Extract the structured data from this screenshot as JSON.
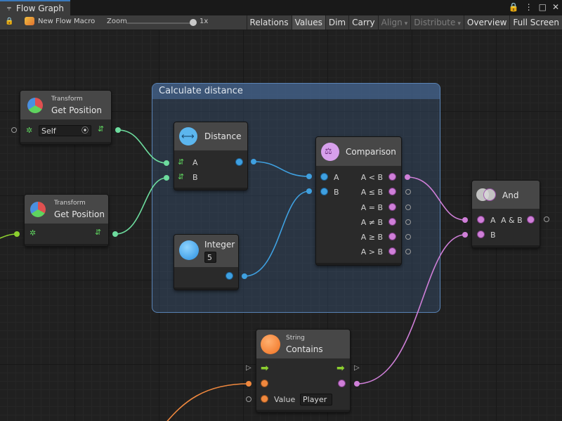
{
  "window": {
    "tab_title": "Flow Graph",
    "tab_icon": "⫧",
    "lock_icon": "🔒",
    "menu_icon": "⋮",
    "maximize_icon": "□",
    "close_icon": "✕"
  },
  "toolbar": {
    "lock_icon": "🔒",
    "macro_name": "New Flow Macro",
    "zoom_label": "Zoom",
    "zoom_value": "1x",
    "zoom_fraction": 0.92,
    "buttons": {
      "relations": "Relations",
      "values": "Values",
      "dim": "Dim",
      "carry": "Carry",
      "align": "Align",
      "distribute": "Distribute",
      "overview": "Overview",
      "fullscreen": "Full Screen"
    },
    "dropdown_icon": "▾"
  },
  "group": {
    "title": "Calculate distance"
  },
  "nodes": {
    "transform1": {
      "category": "Transform",
      "title": "Get Position",
      "field_value": "Self",
      "target_icon": "⦿"
    },
    "transform2": {
      "category": "Transform",
      "title": "Get Position"
    },
    "distance": {
      "title": "Distance",
      "port_a": "A",
      "port_b": "B"
    },
    "integer": {
      "title": "Integer",
      "value": "5"
    },
    "comparison": {
      "title": "Comparison",
      "port_a": "A",
      "port_b": "B",
      "outputs": [
        "A < B",
        "A ≤ B",
        "A = B",
        "A ≠ B",
        "A ≥ B",
        "A > B"
      ]
    },
    "and": {
      "title": "And",
      "port_a": "A",
      "port_b": "B",
      "output": "A & B"
    },
    "string_contains": {
      "category": "String",
      "title": "Contains",
      "value_label": "Value",
      "value": "Player"
    }
  },
  "colors": {
    "vector3": "#6ddc9e",
    "float": "#3fa0e0",
    "bool": "#cf7fd8",
    "string": "#f0883e",
    "flow": "#8ccf2f",
    "group": "#5a84b6"
  }
}
